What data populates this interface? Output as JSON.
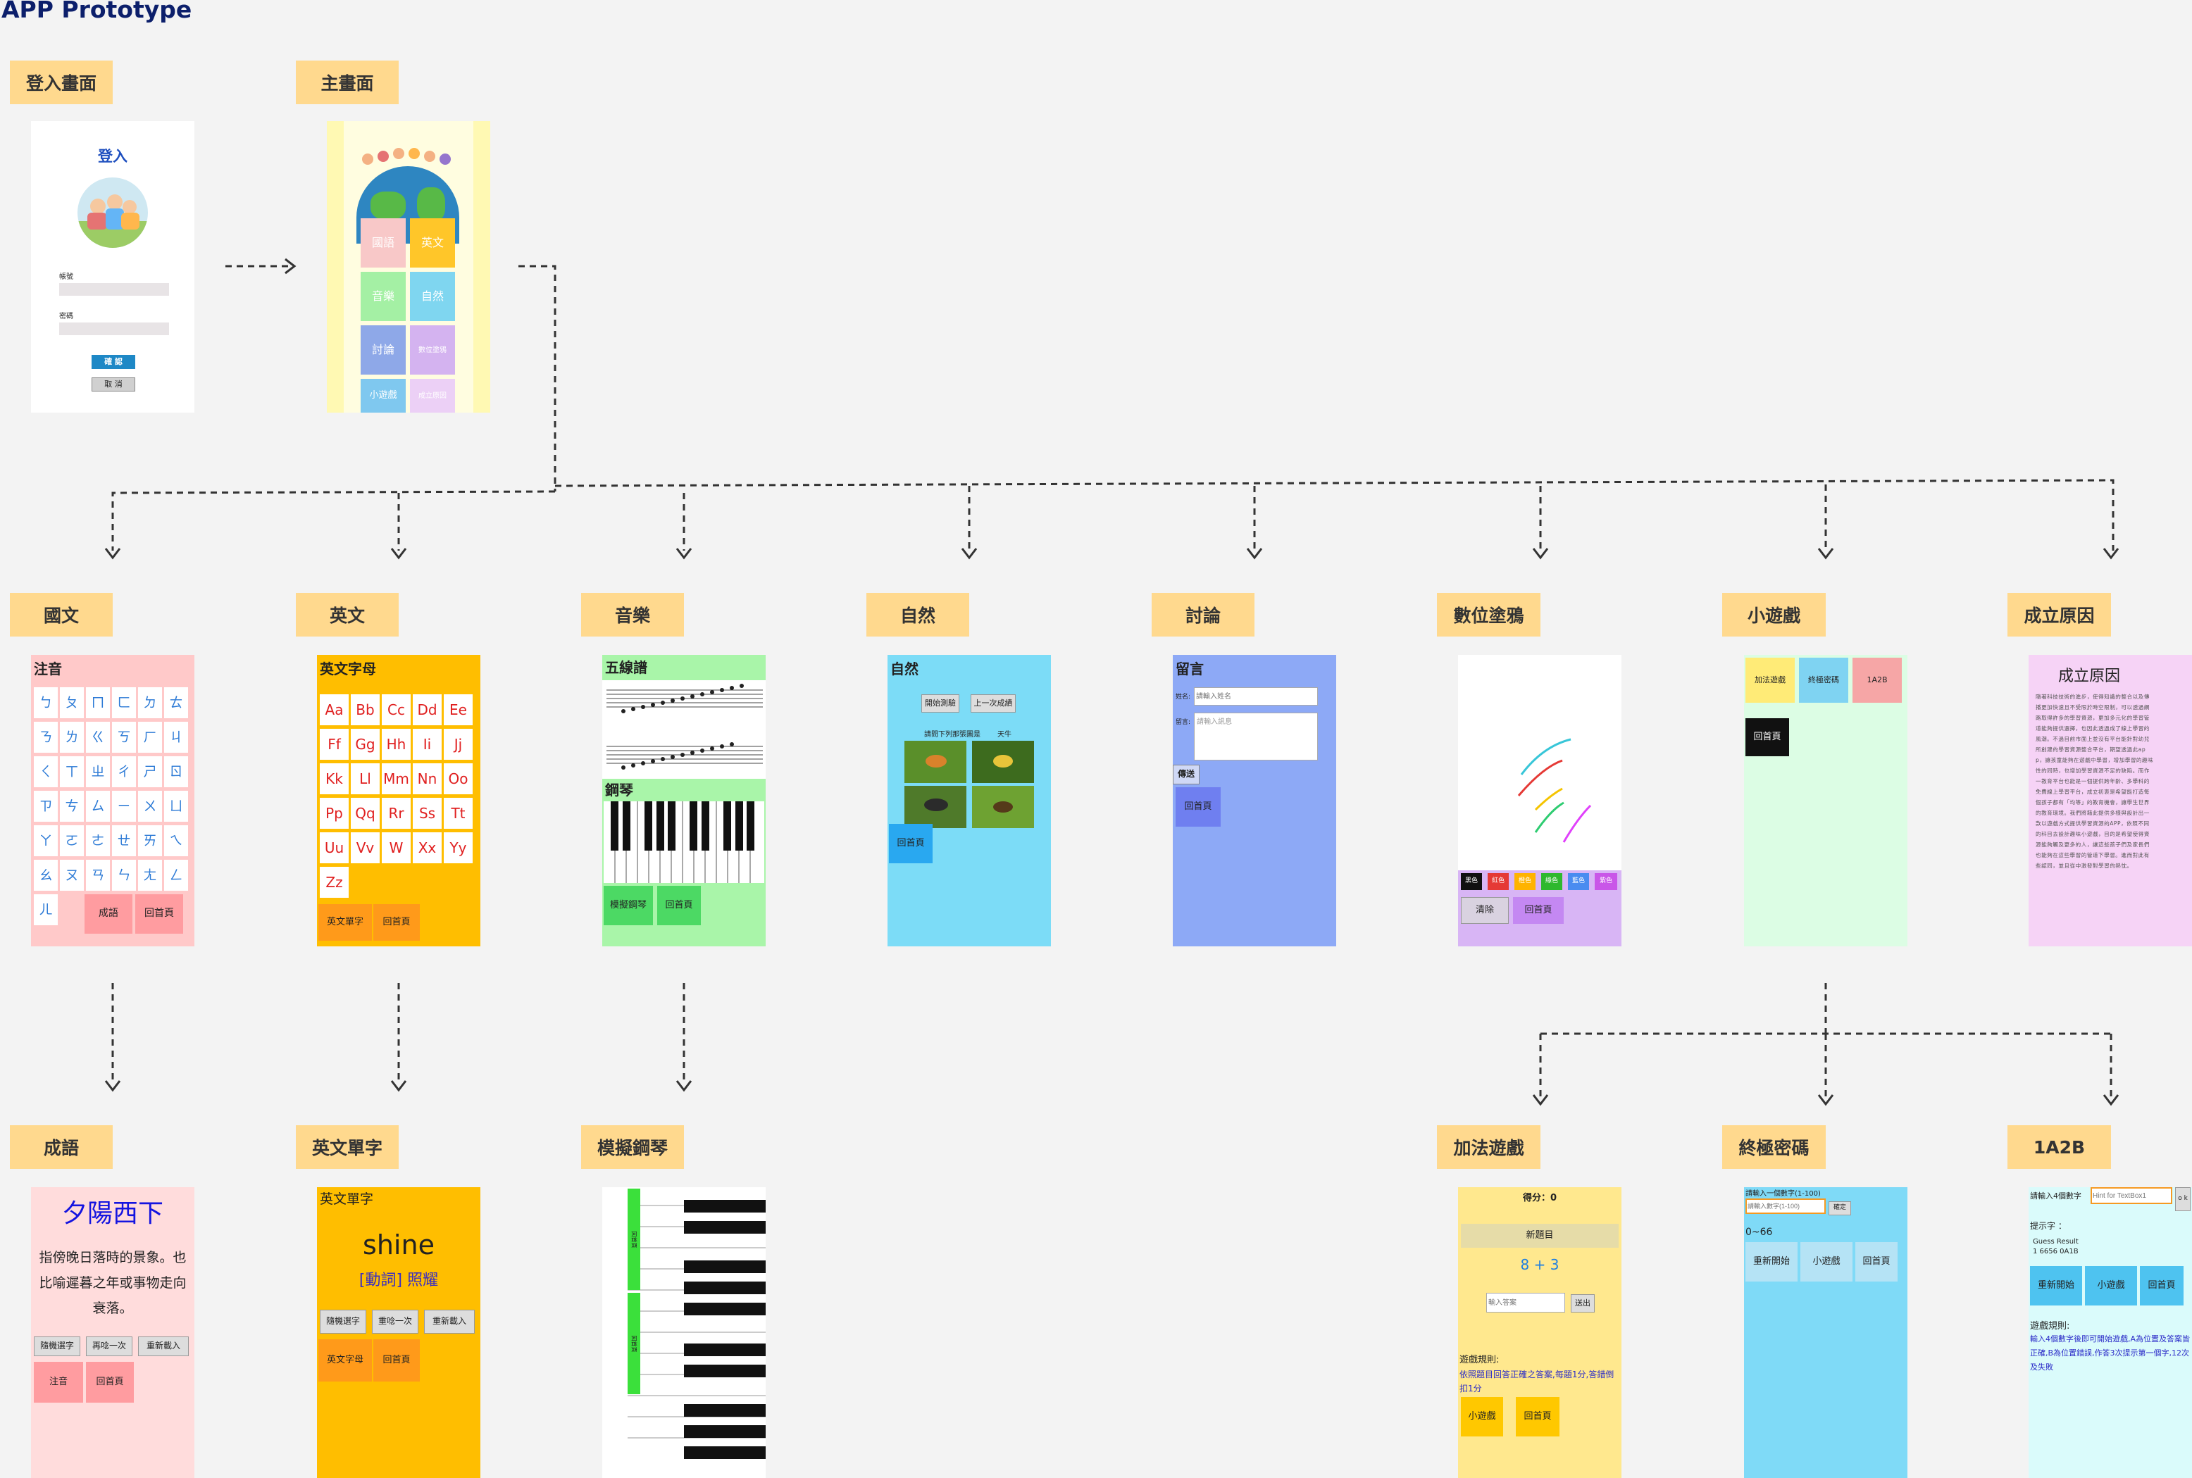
{
  "title": "APP Prototype",
  "labels": {
    "login": "登入畫面",
    "main": "主畫面",
    "chinese": "國文",
    "english": "英文",
    "music": "音樂",
    "nature": "自然",
    "discuss": "討論",
    "paint": "數位塗鴉",
    "games": "小遊戲",
    "reason": "成立原因",
    "idiom": "成語",
    "words": "英文單字",
    "piano": "模擬鋼琴",
    "add": "加法遊戲",
    "ultimate": "終極密碼",
    "ab": "1A2B"
  },
  "login": {
    "heading": "登入",
    "account": "帳號",
    "password": "密碼",
    "ok": "確 認",
    "cancel": "取 消"
  },
  "main": {
    "tiles": [
      "國語",
      "英文",
      "音樂",
      "自然",
      "討論",
      "數位塗鴉",
      "小遊戲",
      "成立原因"
    ]
  },
  "chinese": {
    "header": "注音",
    "symbols": [
      "ㄅ",
      "ㄆ",
      "ㄇ",
      "ㄈ",
      "ㄉ",
      "ㄊ",
      "ㄋ",
      "ㄌ",
      "ㄍ",
      "ㄎ",
      "ㄏ",
      "ㄐ",
      "ㄑ",
      "ㄒ",
      "ㄓ",
      "ㄔ",
      "ㄕ",
      "ㄖ",
      "ㄗ",
      "ㄘ",
      "ㄙ",
      "ㄧ",
      "ㄨ",
      "ㄩ",
      "ㄚ",
      "ㄛ",
      "ㄜ",
      "ㄝ",
      "ㄞ",
      "ㄟ",
      "ㄠ",
      "ㄡ",
      "ㄢ",
      "ㄣ",
      "ㄤ",
      "ㄥ",
      "ㄦ"
    ],
    "btn_idiom": "成語",
    "btn_home": "回首頁"
  },
  "english": {
    "header": "英文字母",
    "letters": [
      "Aa",
      "Bb",
      "Cc",
      "Dd",
      "Ee",
      "Ff",
      "Gg",
      "Hh",
      "Ii",
      "Jj",
      "Kk",
      "Ll",
      "Mm",
      "Nn",
      "Oo",
      "Pp",
      "Qq",
      "Rr",
      "Ss",
      "Tt",
      "Uu",
      "Vv",
      "W",
      "Xx",
      "Yy",
      "Zz"
    ],
    "btn_words": "英文單字",
    "btn_home": "回首頁"
  },
  "music": {
    "staff_header": "五線譜",
    "piano_header": "鋼琴",
    "btn_piano": "模擬鋼琴",
    "btn_home": "回首頁"
  },
  "nature": {
    "header": "自然",
    "btn_start": "開始測驗",
    "btn_last": "上一次成績",
    "question": "請問下列那張圖是",
    "answer": "天牛",
    "btn_home": "回首頁"
  },
  "discuss": {
    "header": "留言",
    "name_label": "姓名:",
    "name_ph": "請輸入姓名",
    "msg_label": "留言:",
    "msg_ph": "請輸入訊息",
    "btn_send": "傳送",
    "btn_home": "回首頁"
  },
  "paint": {
    "colors": [
      "黑色",
      "紅色",
      "橙色",
      "綠色",
      "藍色",
      "紫色"
    ],
    "btn_clear": "清除",
    "btn_home": "回首頁"
  },
  "games": {
    "btn_add": "加法遊戲",
    "btn_ultimate": "終極密碼",
    "btn_ab": "1A2B",
    "btn_home": "回首頁"
  },
  "reason": {
    "header": "成立原因",
    "text": "隨著科技技術的進步，使得知識的整合以及傳播更加快速且不受限於時空限制，可以透過網路取得許多的學習資源，更加多元化的學習管道能夠提供選擇，也因此透過成了線上學習的風潮。不過目前市面上並沒有平台能針對幼兒所創建的學習資源整合平台，期望透過此app，讓孩童能夠在遊戲中學習，增加學習的趣味性的同時，也增加學習資源不足的缺陷。而作一教育平台也能是一個提供跨年齡、多學科的免費線上學習平台，成立初衷是希望能打造每個孩子都有「均等」的教育機會，讓學生世界的教育環境。我們將藉此提供多樣與設計出一款以遊戲方式提供學習資源的APP，依照不同的科目去設計趣味小遊戲，目的是希望使得資源能夠觸及更多的人，讓這些孩子們及家長們也能夠在這些學習的管道下學習。進而對此有些認同，並且從中激發對學習的熱忱。"
  },
  "idiom": {
    "word": "夕陽西下",
    "meaning": "指傍晚日落時的景象。也比喻遲暮之年或事物走向衰落。",
    "btn_random": "隨機選字",
    "btn_again": "再唸一次",
    "btn_reload": "重新載入",
    "btn_zhuyin": "注音",
    "btn_home": "回首頁"
  },
  "words": {
    "header": "英文單字",
    "word": "shine",
    "meaning": "[動詞] 照耀",
    "btn_random": "隨機選字",
    "btn_again": "重唸一次",
    "btn_reload": "重新載入",
    "btn_letters": "英文字母",
    "btn_home": "回首頁"
  },
  "piano": {
    "label_a": "回首頁",
    "label_b": "回首頁"
  },
  "add": {
    "score": "得分：0",
    "btn_new": "新題目",
    "question": "8 + 3",
    "input_ph": "輸入答案",
    "btn_submit": "送出",
    "rules_title": "遊戲規則:",
    "rules": "依照題目回答正確之答案,每題1分,答錯倒扣1分",
    "btn_games": "小遊戲",
    "btn_home": "回首頁"
  },
  "ultimate": {
    "prompt": "請輸入一個數字(1-100)",
    "input_ph": "請輸入數字(1-100)",
    "btn_ok": "確定",
    "range": "0~66",
    "btn_restart": "重新開始",
    "btn_games": "小遊戲",
    "btn_home": "回首頁"
  },
  "ab": {
    "prompt": "請輸入4個數字",
    "input_ph": "Hint for TextBox1",
    "btn_ok": "o k",
    "hint_label": "提示字 ：",
    "hint_head": "Guess  Result",
    "hint_row": "1  6656  0A1B",
    "btn_restart": "重新開始",
    "btn_games": "小遊戲",
    "btn_home": "回首頁",
    "rules_title": "遊戲規則:",
    "rules": "輸入4個數字後即可開始遊戲,A為位置及答案皆正確,B為位置錯誤,作答3次提示第一個字,12次及失敗"
  },
  "colors": {
    "label_bg": "#ffd98e",
    "page_bg": "#f3f3f3"
  }
}
